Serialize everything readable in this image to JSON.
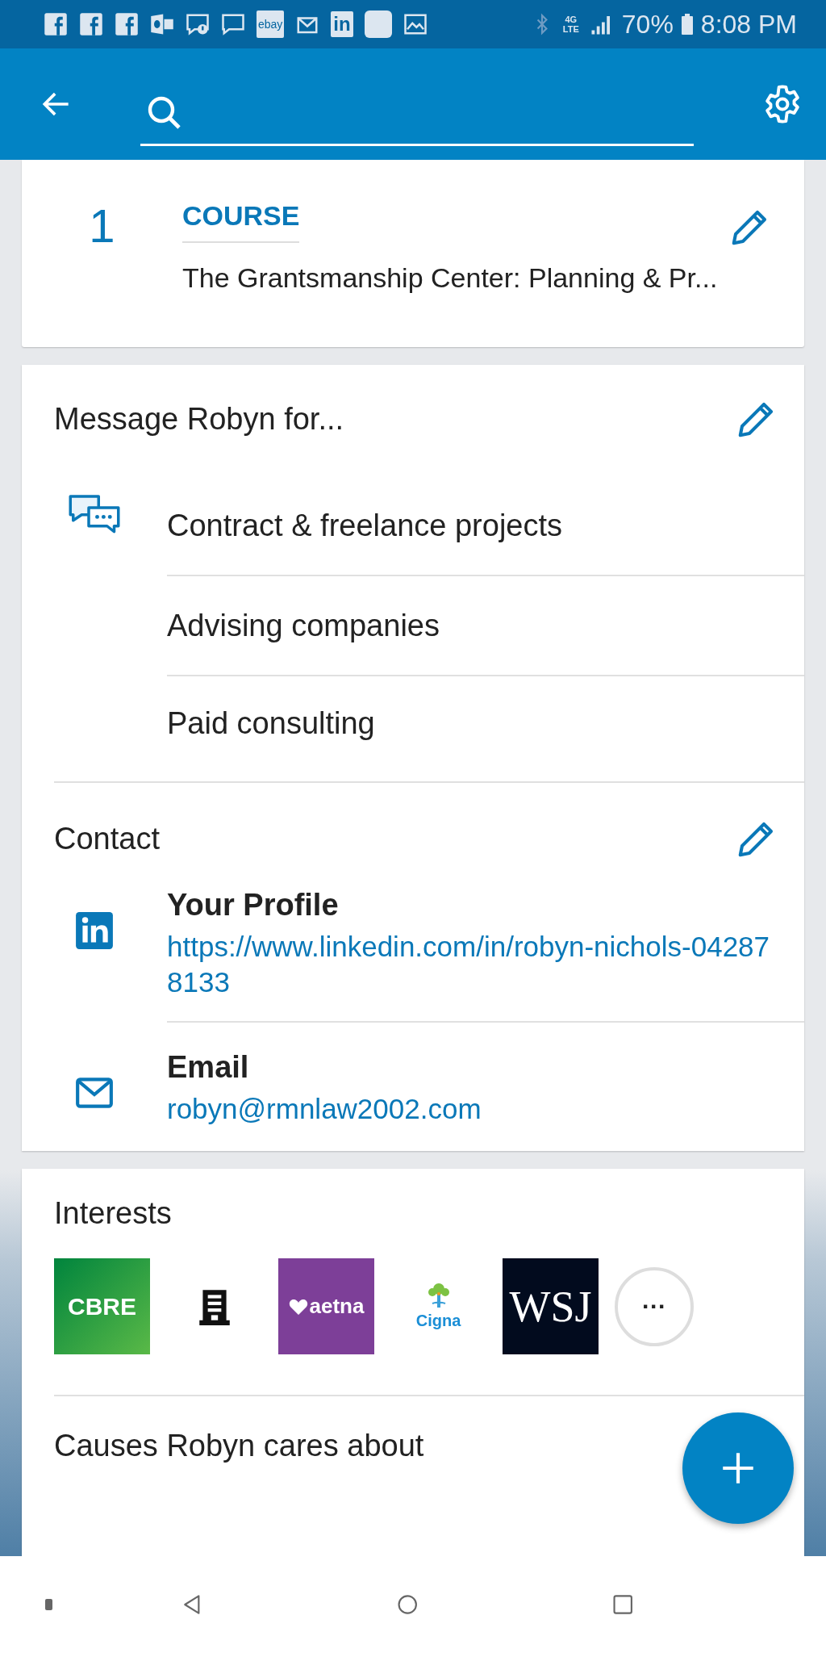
{
  "status_bar": {
    "notifications": [
      {
        "kind": "facebook"
      },
      {
        "kind": "facebook"
      },
      {
        "kind": "facebook"
      },
      {
        "kind": "outlook"
      },
      {
        "kind": "alert-message"
      },
      {
        "kind": "message"
      },
      {
        "kind": "ebay",
        "label": "ebay"
      },
      {
        "kind": "mail"
      },
      {
        "kind": "linkedin",
        "label": "in"
      },
      {
        "kind": "blank"
      },
      {
        "kind": "image"
      }
    ],
    "network": "4G LTE",
    "battery": "70%",
    "time": "8:08 PM"
  },
  "course_card": {
    "count": "1",
    "heading": "COURSE",
    "course": "The Grantsmanship Center: Planning & Pr..."
  },
  "message_card": {
    "title": "Message Robyn for...",
    "items": [
      "Contract & freelance projects",
      "Advising companies",
      "Paid consulting"
    ]
  },
  "contact": {
    "title": "Contact",
    "entries": [
      {
        "kind": "linkedin",
        "label": "Your Profile",
        "value": "https://www.linkedin.com/in/robyn-nichols-042878133"
      },
      {
        "kind": "email",
        "label": "Email",
        "value": "robyn@rmnlaw2002.com"
      }
    ]
  },
  "interests": {
    "title": "Interests",
    "items": [
      {
        "kind": "cbre",
        "label": "CBRE"
      },
      {
        "kind": "building"
      },
      {
        "kind": "aetna",
        "label": "aetna"
      },
      {
        "kind": "cigna",
        "label": "Cigna"
      },
      {
        "kind": "wsj",
        "label": "WSJ"
      }
    ],
    "more": "···"
  },
  "causes": {
    "title": "Causes Robyn cares about"
  }
}
